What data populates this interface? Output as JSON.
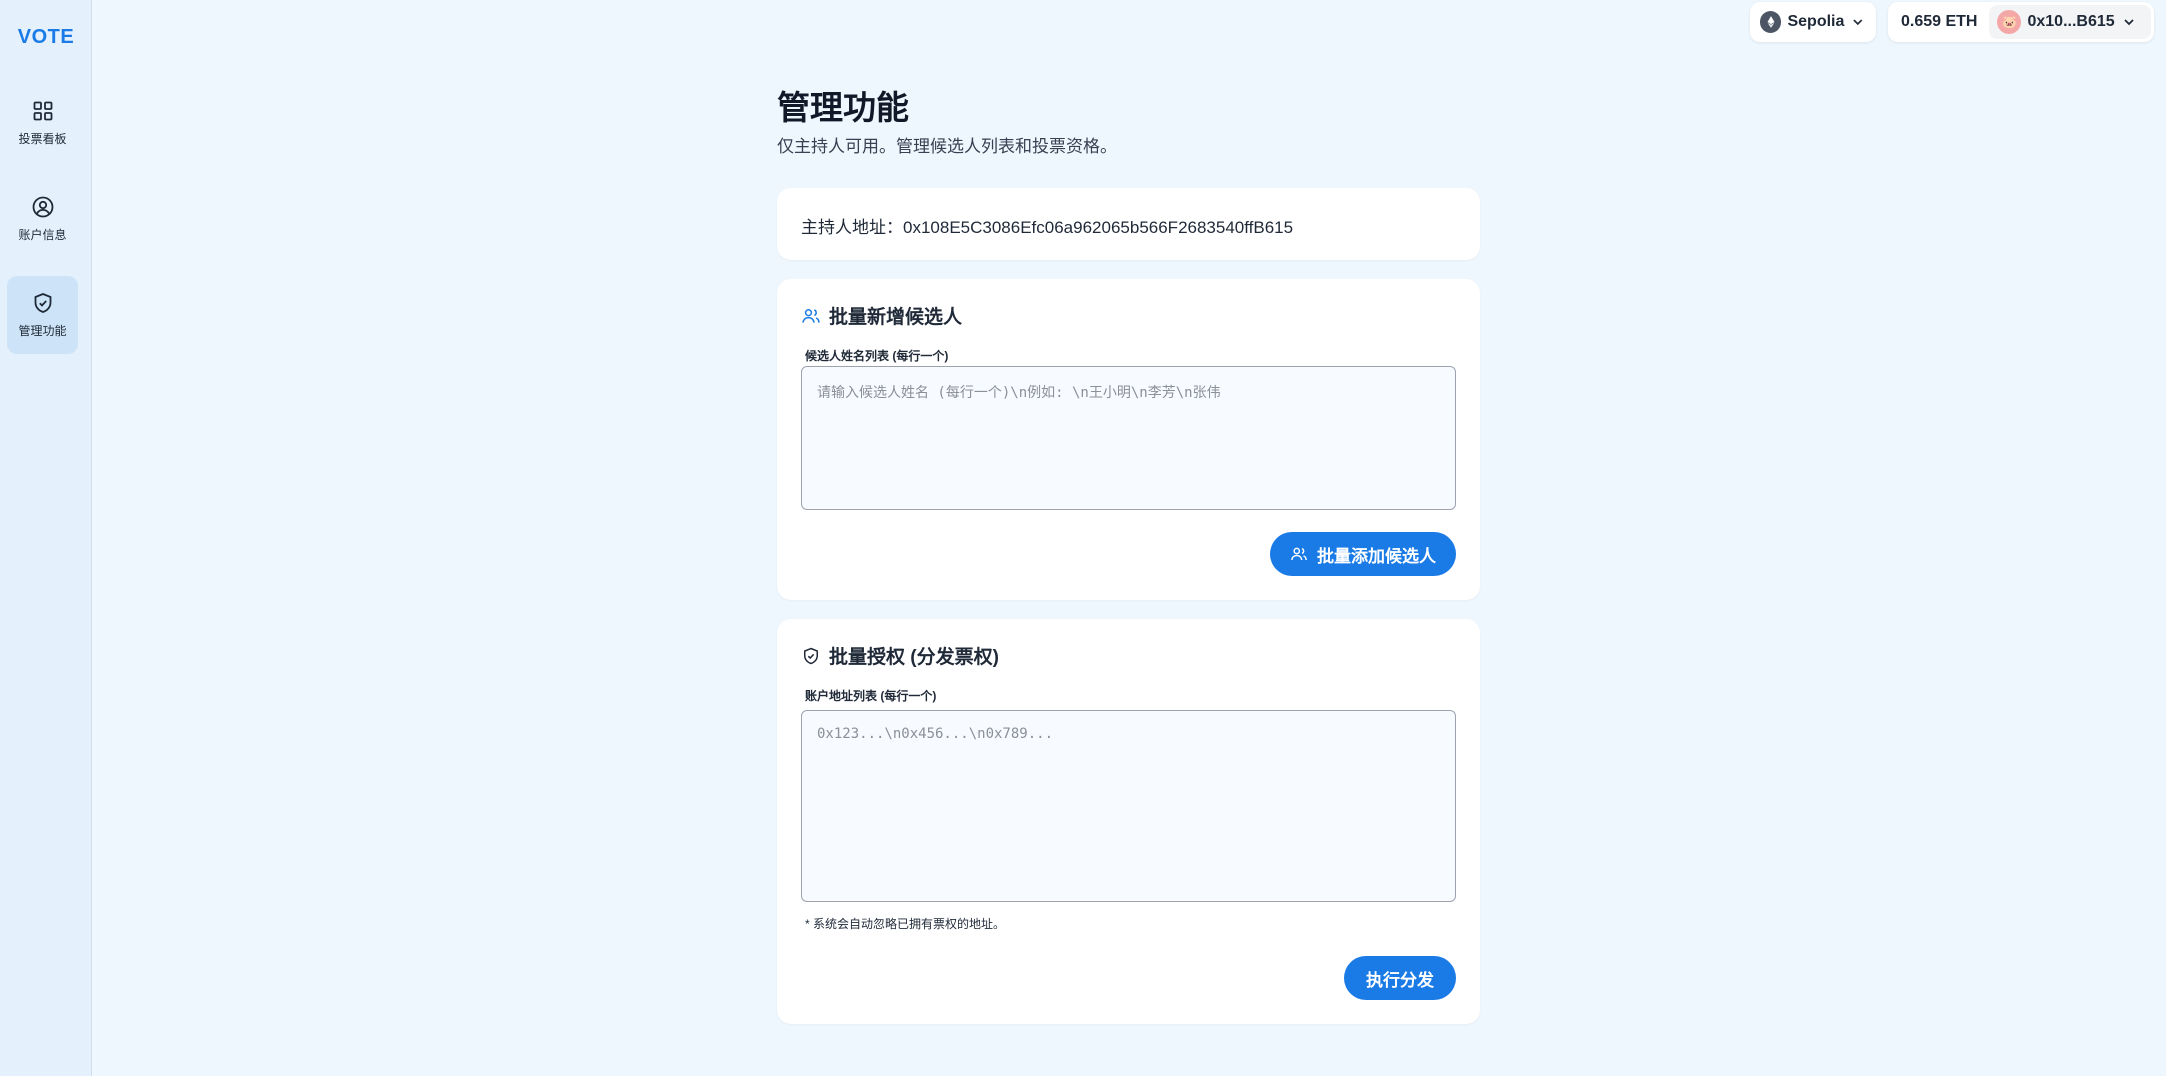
{
  "sidebar": {
    "logo": "VOTE",
    "items": [
      {
        "label": "投票看板",
        "icon": "grid-icon"
      },
      {
        "label": "账户信息",
        "icon": "user-circle-icon"
      },
      {
        "label": "管理功能",
        "icon": "shield-check-icon",
        "active": true
      }
    ]
  },
  "topbar": {
    "network": "Sepolia",
    "balance": "0.659 ETH",
    "address": "0x10...B615"
  },
  "page": {
    "title": "管理功能",
    "subtitle": "仅主持人可用。管理候选人列表和投票资格。"
  },
  "host": {
    "line": "主持人地址：0x108E5C3086Efc06a962065b566F2683540ffB615"
  },
  "candidates": {
    "title": "批量新增候选人",
    "label": "候选人姓名列表 (每行一个)",
    "placeholder": "请输入候选人姓名 (每行一个)\\n例如: \\n王小明\\n李芳\\n张伟",
    "button": "批量添加候选人"
  },
  "authorize": {
    "title": "批量授权 (分发票权)",
    "label": "账户地址列表 (每行一个)",
    "placeholder": "0x123...\\n0x456...\\n0x789...",
    "hint": "* 系统会自动忽略已拥有票权的地址。",
    "button": "执行分发"
  },
  "colors": {
    "accent": "#1a7be6",
    "background": "#eef6fe",
    "sidebar": "#e4f1fc"
  }
}
